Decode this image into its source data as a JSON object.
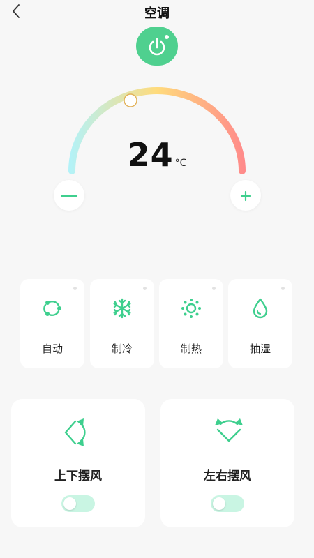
{
  "header": {
    "title": "空调",
    "back_icon": "chevron-left-icon"
  },
  "power": {
    "icon": "power-icon",
    "color": "#4fd08f"
  },
  "thermostat": {
    "temperature": "24",
    "unit": "°C",
    "gradient_colors": [
      "#b3f2f8",
      "#ffdb7c",
      "#ff8a8a"
    ],
    "decrease_icon": "minus-icon",
    "increase_icon": "plus-icon"
  },
  "modes": [
    {
      "label": "自动",
      "icon": "auto-cycle-icon"
    },
    {
      "label": "制冷",
      "icon": "snowflake-icon"
    },
    {
      "label": "制热",
      "icon": "sun-icon"
    },
    {
      "label": "抽湿",
      "icon": "water-drop-icon"
    }
  ],
  "swing": [
    {
      "label": "上下摆风",
      "icon": "vertical-swing-icon",
      "enabled": false
    },
    {
      "label": "左右摆风",
      "icon": "horizontal-swing-icon",
      "enabled": false
    }
  ],
  "accent_color": "#3ecf8e"
}
